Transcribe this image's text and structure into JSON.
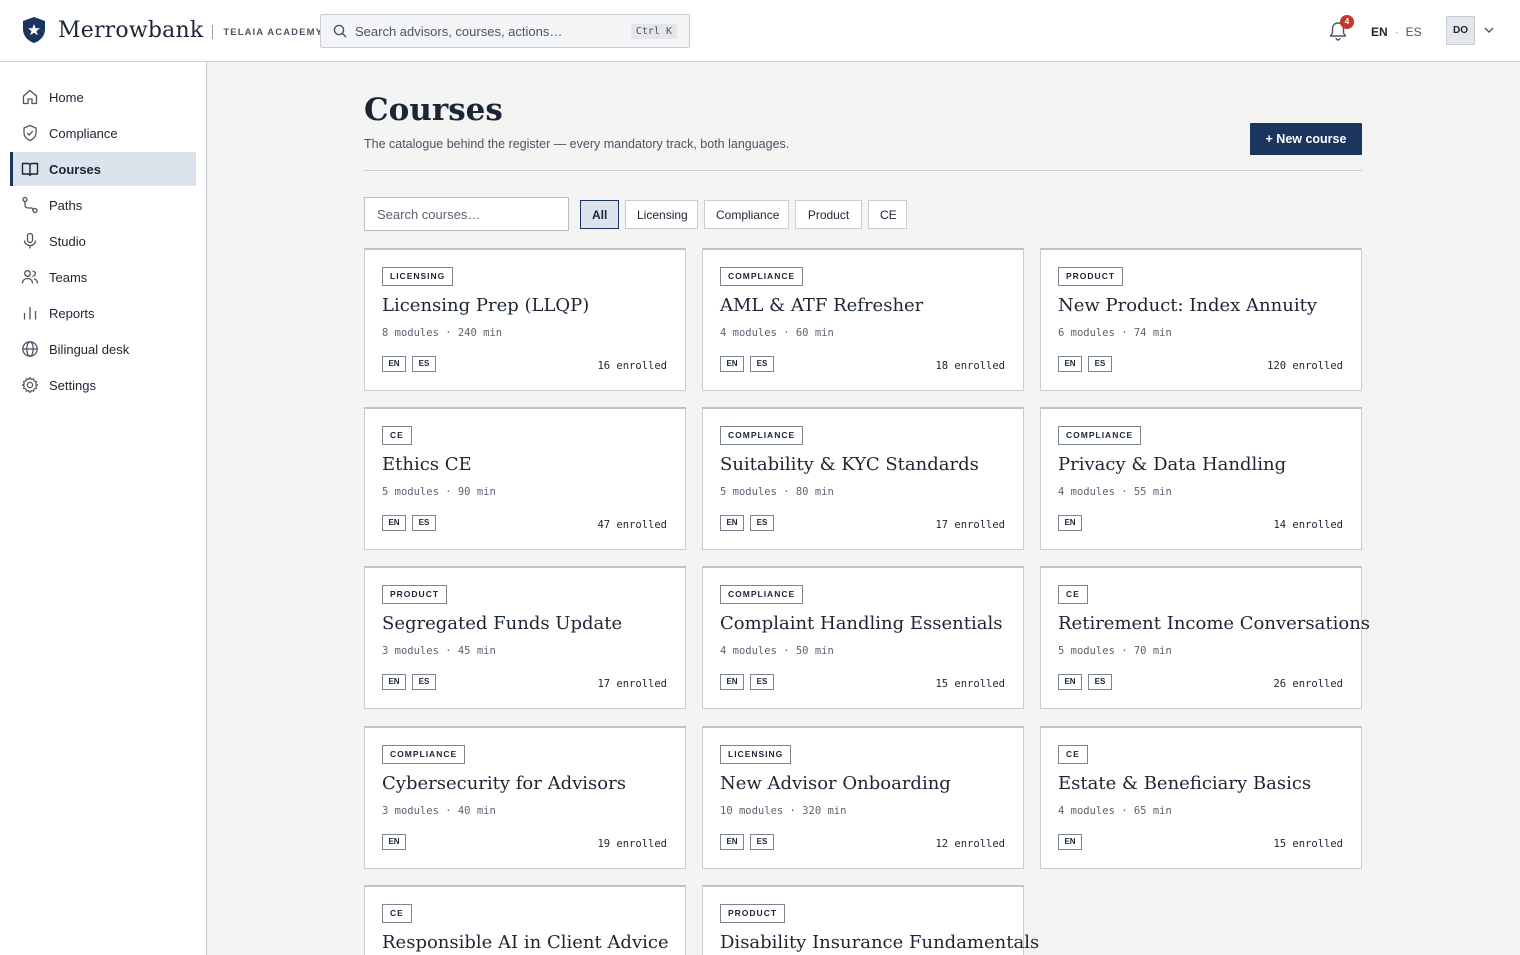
{
  "brand": {
    "name": "Merrowbank",
    "sub": "TELAIA ACADEMY"
  },
  "search": {
    "placeholder": "Search advisors, courses, actions…",
    "shortcut": "Ctrl K"
  },
  "notifications": {
    "count": "4"
  },
  "language": {
    "active": "EN",
    "separator": "·",
    "other": "ES"
  },
  "user": {
    "initials": "DO"
  },
  "sidebar": {
    "items": [
      {
        "label": "Home",
        "icon": "home-icon"
      },
      {
        "label": "Compliance",
        "icon": "shield-check-icon"
      },
      {
        "label": "Courses",
        "icon": "book-open-icon",
        "active": true
      },
      {
        "label": "Paths",
        "icon": "route-icon"
      },
      {
        "label": "Studio",
        "icon": "microphone-icon"
      },
      {
        "label": "Teams",
        "icon": "users-icon"
      },
      {
        "label": "Reports",
        "icon": "bar-chart-icon"
      },
      {
        "label": "Bilingual desk",
        "icon": "globe-icon"
      },
      {
        "label": "Settings",
        "icon": "gear-icon"
      }
    ]
  },
  "page": {
    "title": "Courses",
    "subtitle": "The catalogue behind the register — every mandatory track, both languages.",
    "new_button": "+ New course",
    "course_search_placeholder": "Search courses…"
  },
  "filters": [
    "All",
    "Licensing",
    "Compliance",
    "Product",
    "CE"
  ],
  "courses": [
    {
      "tag": "LICENSING",
      "title": "Licensing Prep (LLQP)",
      "meta": "8 modules · 240 min",
      "langs": [
        "EN",
        "ES"
      ],
      "enrolled": "16 enrolled"
    },
    {
      "tag": "COMPLIANCE",
      "title": "AML & ATF Refresher",
      "meta": "4 modules · 60 min",
      "langs": [
        "EN",
        "ES"
      ],
      "enrolled": "18 enrolled"
    },
    {
      "tag": "PRODUCT",
      "title": "New Product: Index Annuity",
      "meta": "6 modules · 74 min",
      "langs": [
        "EN",
        "ES"
      ],
      "enrolled": "120 enrolled"
    },
    {
      "tag": "CE",
      "title": "Ethics CE",
      "meta": "5 modules · 90 min",
      "langs": [
        "EN",
        "ES"
      ],
      "enrolled": "47 enrolled"
    },
    {
      "tag": "COMPLIANCE",
      "title": "Suitability & KYC Standards",
      "meta": "5 modules · 80 min",
      "langs": [
        "EN",
        "ES"
      ],
      "enrolled": "17 enrolled"
    },
    {
      "tag": "COMPLIANCE",
      "title": "Privacy & Data Handling",
      "meta": "4 modules · 55 min",
      "langs": [
        "EN"
      ],
      "enrolled": "14 enrolled"
    },
    {
      "tag": "PRODUCT",
      "title": "Segregated Funds Update",
      "meta": "3 modules · 45 min",
      "langs": [
        "EN",
        "ES"
      ],
      "enrolled": "17 enrolled"
    },
    {
      "tag": "COMPLIANCE",
      "title": "Complaint Handling Essentials",
      "meta": "4 modules · 50 min",
      "langs": [
        "EN",
        "ES"
      ],
      "enrolled": "15 enrolled"
    },
    {
      "tag": "CE",
      "title": "Retirement Income Conversations",
      "meta": "5 modules · 70 min",
      "langs": [
        "EN",
        "ES"
      ],
      "enrolled": "26 enrolled"
    },
    {
      "tag": "COMPLIANCE",
      "title": "Cybersecurity for Advisors",
      "meta": "3 modules · 40 min",
      "langs": [
        "EN"
      ],
      "enrolled": "19 enrolled"
    },
    {
      "tag": "LICENSING",
      "title": "New Advisor Onboarding",
      "meta": "10 modules · 320 min",
      "langs": [
        "EN",
        "ES"
      ],
      "enrolled": "12 enrolled"
    },
    {
      "tag": "CE",
      "title": "Estate & Beneficiary Basics",
      "meta": "4 modules · 65 min",
      "langs": [
        "EN"
      ],
      "enrolled": "15 enrolled"
    },
    {
      "tag": "CE",
      "title": "Responsible AI in Client Advice",
      "meta": "",
      "langs": [],
      "enrolled": ""
    },
    {
      "tag": "PRODUCT",
      "title": "Disability Insurance Fundamentals",
      "meta": "",
      "langs": [],
      "enrolled": ""
    }
  ],
  "colors": {
    "accent": "#1c355e",
    "active_bg": "#dde3ec",
    "badge": "#c0392b"
  }
}
